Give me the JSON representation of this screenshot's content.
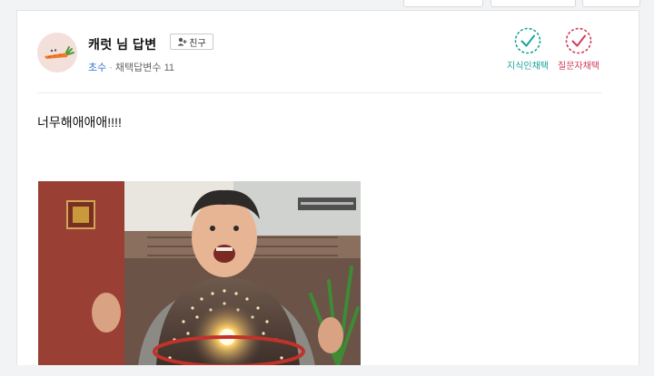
{
  "answer_header": {
    "author_name": "캐럿 님 답변",
    "friend_button_label": "친구",
    "level": "초수",
    "separator": "·",
    "selected_answers_label": "채택답변수",
    "selected_answers_count": "11"
  },
  "adoption_badges": [
    {
      "label": "지식인채택",
      "color": "#1aa39a"
    },
    {
      "label": "질문자채택",
      "color": "#d23c5a"
    }
  ],
  "answer": {
    "text": "너무해애애애!!!!"
  },
  "icons": {
    "avatar": "carrot-avatar",
    "friend": "add-person-icon",
    "expert_check": "check-circle-icon",
    "asker_check": "check-circle-icon"
  }
}
